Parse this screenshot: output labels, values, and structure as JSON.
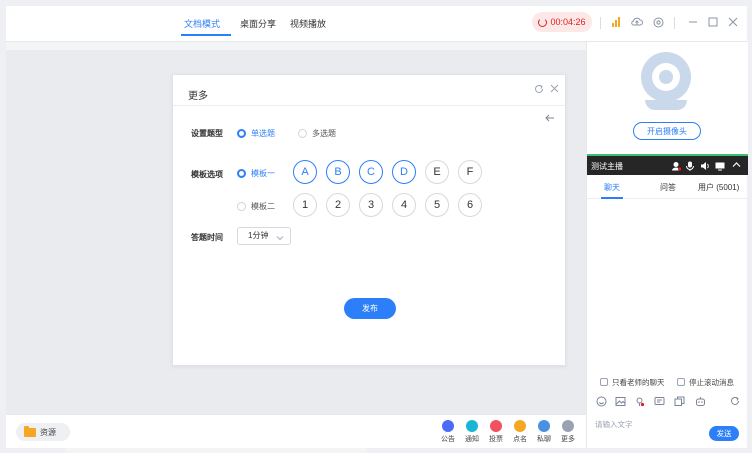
{
  "tabs": [
    {
      "label": "文档模式",
      "active": true
    },
    {
      "label": "桌面分享",
      "active": false
    },
    {
      "label": "视频播放",
      "active": false
    }
  ],
  "timer": "00:04:26",
  "icons": {
    "signal": "signal-icon",
    "cloud": "cloud-upload-icon",
    "settings": "gear-icon",
    "minimize": "minimize-icon",
    "maximize": "maximize-icon",
    "close": "close-icon"
  },
  "colors": {
    "accent": "#2d7ff9",
    "timer_red": "#e02020",
    "host_bar": "#262626"
  },
  "modal": {
    "title": "更多",
    "question_type_label": "设置题型",
    "single_choice": "单选题",
    "multi_choice": "多选题",
    "template_label": "模板选项",
    "template_one": "模板一",
    "template_two": "模板二",
    "template_one_options": [
      "A",
      "B",
      "C",
      "D",
      "E",
      "F"
    ],
    "template_two_options": [
      "1",
      "2",
      "3",
      "4",
      "5",
      "6"
    ],
    "template_one_highlighted": [
      true,
      true,
      true,
      true,
      false,
      false
    ],
    "answer_time_label": "答题时间",
    "answer_time_value": "1分钟",
    "publish": "发布"
  },
  "bottombar": {
    "resources": "资源",
    "tools": [
      {
        "label": "公告",
        "color": "#4a6cf7"
      },
      {
        "label": "通知",
        "color": "#19b6d4"
      },
      {
        "label": "投票",
        "color": "#f0525f"
      },
      {
        "label": "点名",
        "color": "#f5a623"
      },
      {
        "label": "私聊",
        "color": "#4a90e2"
      },
      {
        "label": "更多",
        "color": "#9aa2b1"
      }
    ]
  },
  "right": {
    "camera_button": "开启摄像头",
    "host_name": "测试主播",
    "chat_tabs": [
      "聊天",
      "问答",
      "用户 (5001)"
    ],
    "only_teacher": "只看老师的聊天",
    "stop_scroll": "停止滚动消息",
    "input_placeholder": "请输入文字",
    "send": "发送"
  }
}
